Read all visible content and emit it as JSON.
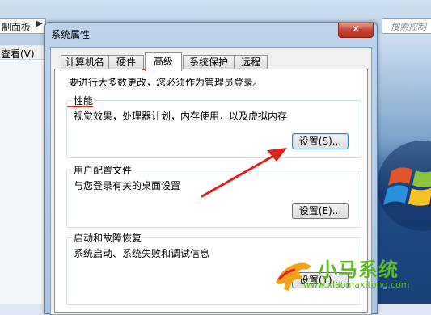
{
  "background": {
    "address_text": "制面板",
    "search_placeholder": "搜索控制面",
    "menu_text": "查看(V)"
  },
  "dialog": {
    "title": "系统属性",
    "close_symbol": "✕",
    "tabs": [
      {
        "label": "计算机名",
        "active": false
      },
      {
        "label": "硬件",
        "active": false
      },
      {
        "label": "高级",
        "active": true
      },
      {
        "label": "系统保护",
        "active": false
      },
      {
        "label": "远程",
        "active": false
      }
    ],
    "intro": "要进行大多数更改，您必须作为管理员登录。",
    "performance": {
      "title": "性能",
      "desc": "视觉效果，处理器计划，内存使用，以及虚拟内存",
      "button": "设置(S)..."
    },
    "profiles": {
      "title": "用户配置文件",
      "desc": "与您登录有关的桌面设置",
      "button": "设置(E)..."
    },
    "startup": {
      "title": "启动和故障恢复",
      "desc": "系统启动、系统失败和调试信息",
      "button": "设置(T)..."
    }
  },
  "watermark": {
    "name": "小马系统",
    "url": "www.xiaomaxitong.com"
  },
  "colors": {
    "annotation_red": "#e0201a",
    "watermark_green": "#5fb81f"
  }
}
